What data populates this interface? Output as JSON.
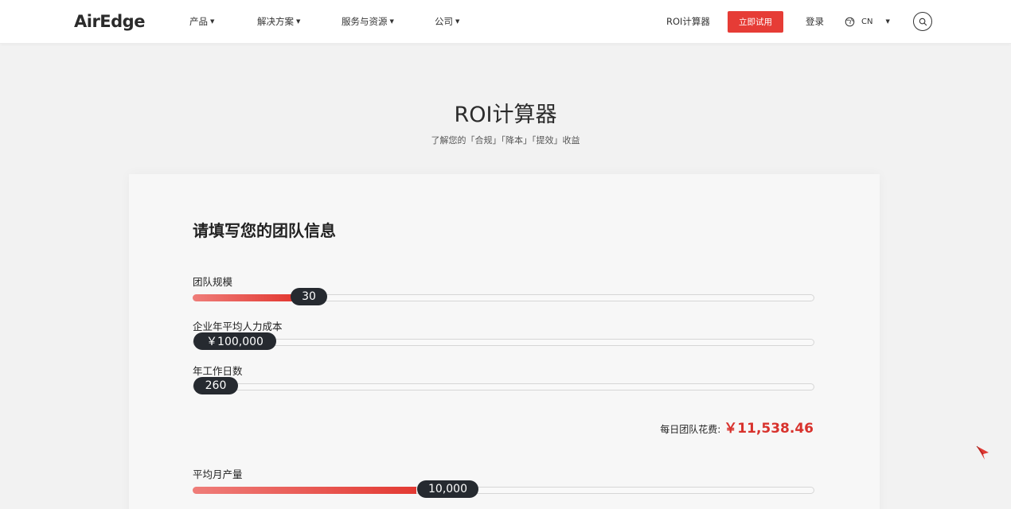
{
  "header": {
    "logo": "AirEdge",
    "nav": [
      {
        "label": "产品"
      },
      {
        "label": "解决方案"
      },
      {
        "label": "服务与资源"
      },
      {
        "label": "公司"
      }
    ],
    "roi_link": "ROI计算器",
    "cta_label": "立即试用",
    "login_label": "登录",
    "language": "CN"
  },
  "hero": {
    "title": "ROI计算器",
    "subtitle": "了解您的「合规」「降本」「提效」收益"
  },
  "form": {
    "section_title": "请填写您的团队信息",
    "sliders": [
      {
        "label": "团队规模",
        "value_text": "30",
        "level_percent": 16
      },
      {
        "label": "企业年平均人力成本",
        "value_text": "￥100,000",
        "level_percent": 0
      },
      {
        "label": "年工作日数",
        "value_text": "260",
        "level_percent": 0
      }
    ],
    "daily_cost_label": "每日团队花费:",
    "daily_cost_value": "￥11,538.46",
    "monthly_output": {
      "label": "平均月产量",
      "value_text": "10,000",
      "level_percent": 36
    }
  },
  "colors": {
    "accent": "#e63c36",
    "thumb": "#262a30",
    "value_red": "#d8322d"
  },
  "icons": [
    "globe-icon",
    "search-icon",
    "cursor-icon",
    "caret-down-icon"
  ]
}
